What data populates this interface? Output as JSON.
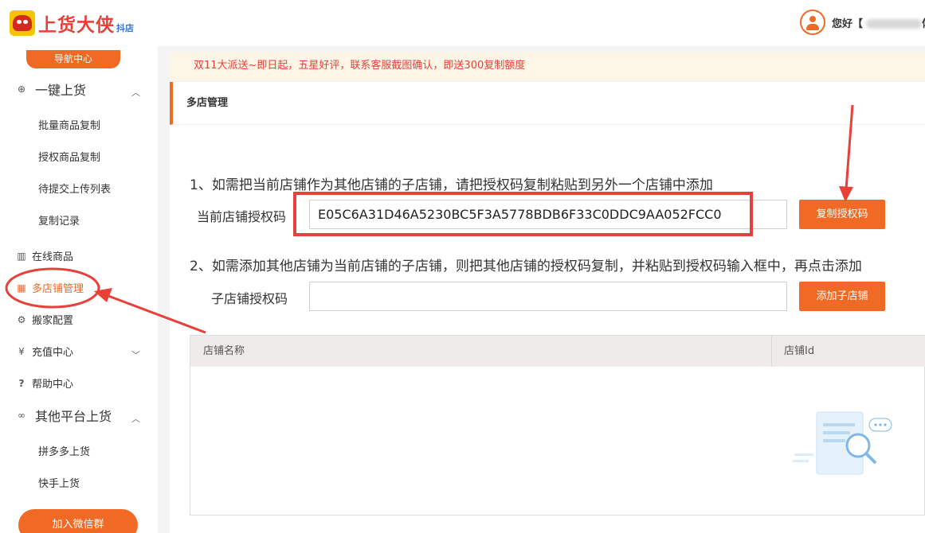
{
  "header": {
    "logo_text": "上货大侠",
    "logo_sub": "抖店",
    "greeting": "您好【",
    "greeting_tail": "体"
  },
  "sidebar": {
    "nav_center": "导航中心",
    "one_click": "一键上货",
    "batch_copy": "批量商品复制",
    "auth_copy": "授权商品复制",
    "pending_upload": "待提交上传列表",
    "copy_records": "复制记录",
    "online_products": "在线商品",
    "multi_store": "多店铺管理",
    "move_config": "搬家配置",
    "recharge": "充值中心",
    "help": "帮助中心",
    "other_platforms": "其他平台上货",
    "pdd": "拼多多上货",
    "kuaishou": "快手上货",
    "join_wechat": "加入微信群"
  },
  "notice": "双11大派送~即日起，五星好评，联系客服截图确认，即送300复制额度",
  "main": {
    "title": "多店管理",
    "step1": "1、如需把当前店铺作为其他店铺的子店铺，请把授权码复制粘贴到另外一个店铺中添加",
    "current_code_label": "当前店铺授权码",
    "current_code_value": "E05C6A31D46A5230BC5F3A5778BDB6F33C0DDC9AA052FCC0",
    "copy_code_button": "复制授权码",
    "step2": "2、如需添加其他店铺为当前店铺的子店铺，则把其他店铺的授权码复制，并粘贴到授权码输入框中，再点击添加",
    "child_code_label": "子店铺授权码",
    "child_code_placeholder": "",
    "add_child_button": "添加子店铺",
    "table": {
      "col_name": "店铺名称",
      "col_id": "店铺Id"
    }
  },
  "colors": {
    "accent": "#f06a26",
    "annotation_red": "#e8413a",
    "notice_bg": "#fdf6e7"
  }
}
